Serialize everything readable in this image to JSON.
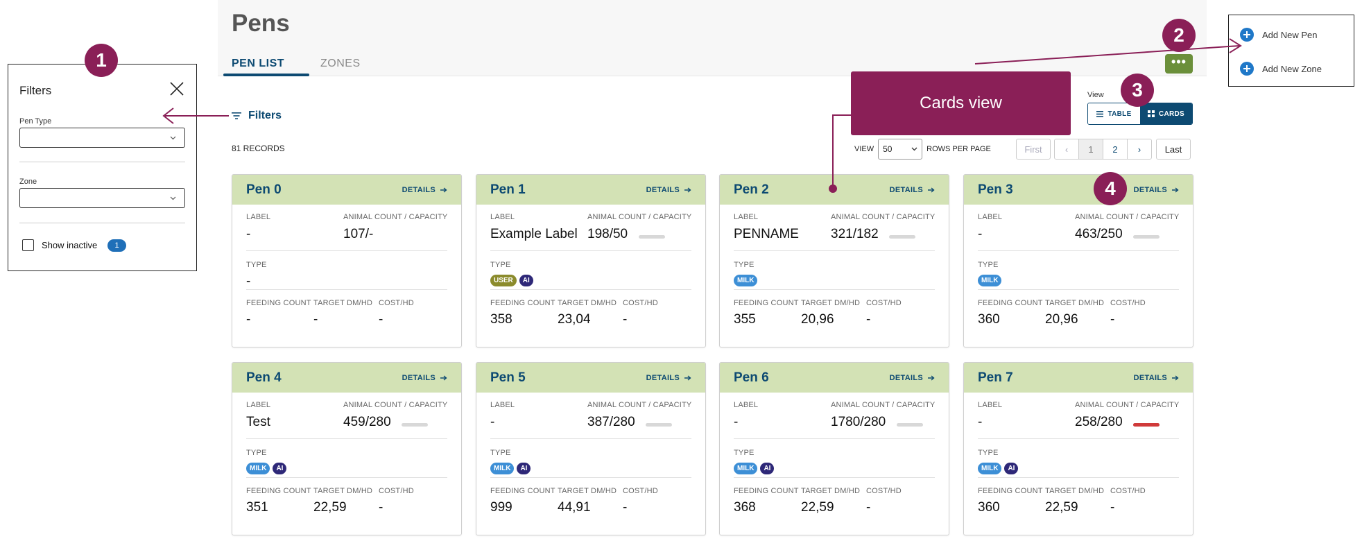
{
  "header": {
    "title": "Pens",
    "tabs": [
      {
        "label": "PEN LIST",
        "active": true
      },
      {
        "label": "ZONES",
        "active": false
      }
    ],
    "more_label": "•••"
  },
  "toolbar": {
    "filters_label": "Filters",
    "records": "81 RECORDS",
    "view_label": "View",
    "view_table": "TABLE",
    "view_cards": "CARDS",
    "view_prefix": "VIEW",
    "rows_value": "50",
    "rows_suffix": "ROWS PER PAGE"
  },
  "pagination": {
    "first": "First",
    "prev": "‹",
    "pages": [
      "1",
      "2"
    ],
    "next": "›",
    "last": "Last"
  },
  "card_labels": {
    "details": "DETAILS",
    "label": "LABEL",
    "capacity": "ANIMAL COUNT / CAPACITY",
    "type": "TYPE",
    "feeding": "FEEDING COUNT",
    "target": "TARGET DM/HD",
    "cost": "COST/HD"
  },
  "pens": [
    {
      "name": "Pen 0",
      "label": "-",
      "count": "107/-",
      "type": "-",
      "badges": [],
      "capacity_ratio": null,
      "feeding": "-",
      "target": "-",
      "cost": "-"
    },
    {
      "name": "Pen 1",
      "label": "Example Label",
      "count": "198/50",
      "badges": [
        "USER",
        "AI"
      ],
      "capacity_ratio": 0,
      "feeding": "358",
      "target": "23,04",
      "cost": "-"
    },
    {
      "name": "Pen 2",
      "label": "PENNAME",
      "count": "321/182",
      "badges": [
        "MILK"
      ],
      "capacity_ratio": 0,
      "feeding": "355",
      "target": "20,96",
      "cost": "-"
    },
    {
      "name": "Pen 3",
      "label": "-",
      "count": "463/250",
      "badges": [
        "MILK"
      ],
      "capacity_ratio": 0,
      "feeding": "360",
      "target": "20,96",
      "cost": "-"
    },
    {
      "name": "Pen 4",
      "label": "Test",
      "count": "459/280",
      "badges": [
        "MILK",
        "AI"
      ],
      "capacity_ratio": 0,
      "feeding": "351",
      "target": "22,59",
      "cost": "-"
    },
    {
      "name": "Pen 5",
      "label": "-",
      "count": "387/280",
      "badges": [
        "MILK",
        "AI"
      ],
      "capacity_ratio": 0,
      "feeding": "999",
      "target": "44,91",
      "cost": "-"
    },
    {
      "name": "Pen 6",
      "label": "-",
      "count": "1780/280",
      "badges": [
        "MILK",
        "AI"
      ],
      "capacity_ratio": 0,
      "feeding": "368",
      "target": "22,59",
      "cost": "-"
    },
    {
      "name": "Pen 7",
      "label": "-",
      "count": "258/280",
      "badges": [
        "MILK",
        "AI"
      ],
      "capacity_ratio": 1,
      "bar_color": "#d03a3a",
      "feeding": "360",
      "target": "22,59",
      "cost": "-"
    }
  ],
  "filters_panel": {
    "title": "Filters",
    "pen_type_label": "Pen Type",
    "zone_label": "Zone",
    "show_inactive_label": "Show inactive",
    "inactive_count": "1"
  },
  "add_menu": {
    "items": [
      "Add New Pen",
      "Add New Zone"
    ]
  },
  "annotations": {
    "steps": [
      "1",
      "2",
      "3",
      "4"
    ],
    "callout": "Cards view"
  },
  "colors": {
    "primary": "#0d4a72",
    "card_header": "#d3e2b5",
    "annotation": "#8a1f57",
    "more_button": "#6b8f3a"
  }
}
